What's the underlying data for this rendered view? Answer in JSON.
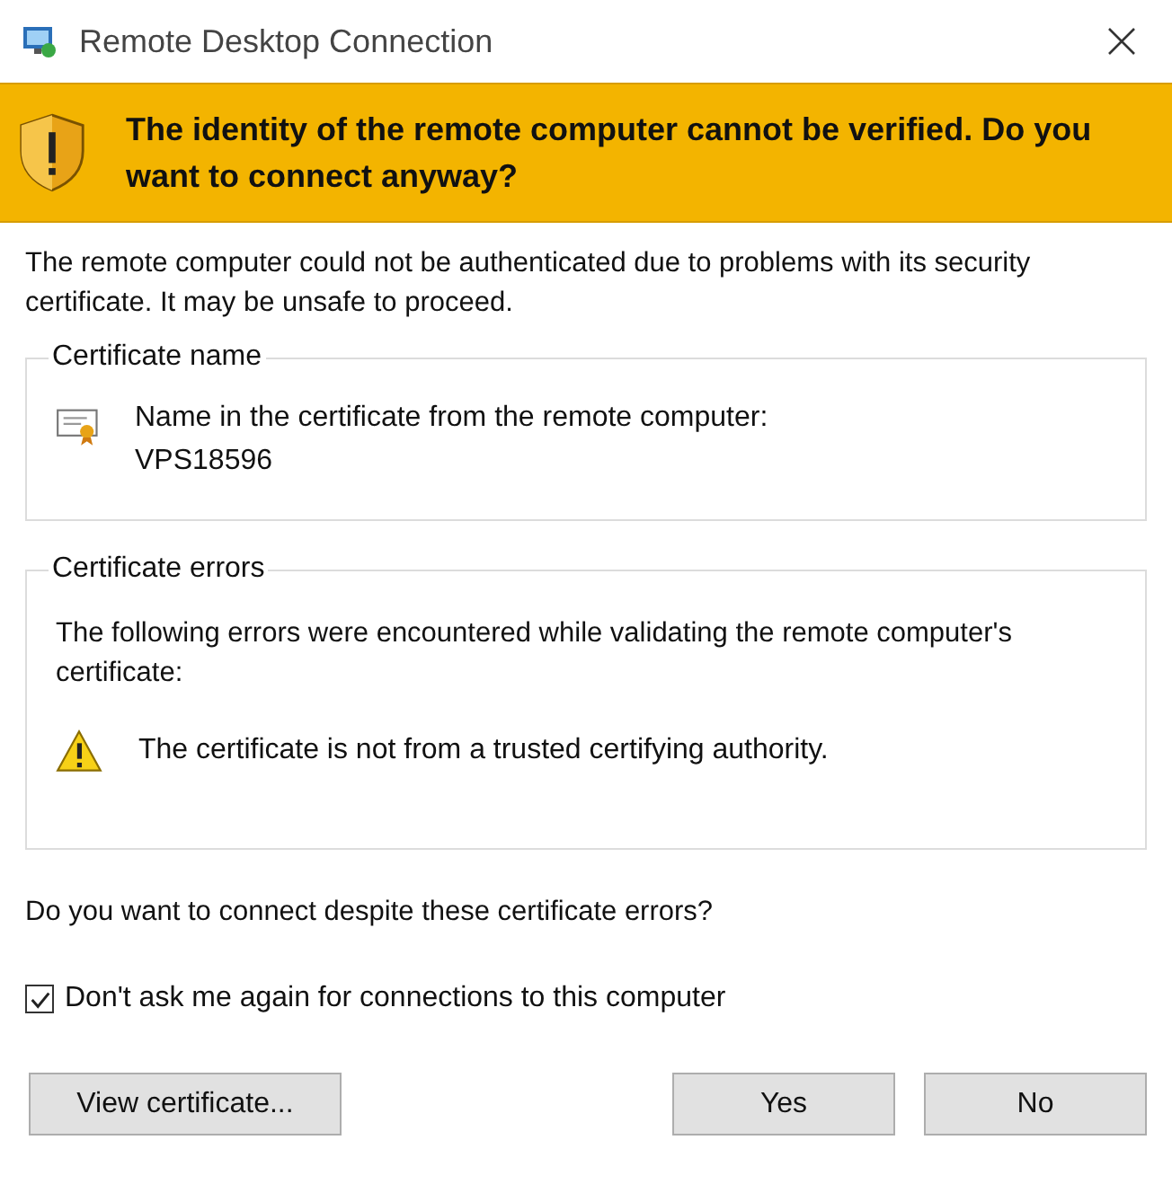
{
  "window": {
    "title": "Remote Desktop Connection"
  },
  "banner": {
    "text": "The identity of the remote computer cannot be verified. Do you want to connect anyway?"
  },
  "intro": "The remote computer could not be authenticated due to problems with its security certificate. It may be unsafe to proceed.",
  "certificate_name": {
    "title": "Certificate name",
    "label": "Name in the certificate from the remote computer:",
    "value": "VPS18596"
  },
  "certificate_errors": {
    "title": "Certificate errors",
    "description": "The following errors were encountered while validating the remote computer's certificate:",
    "errors": [
      "The certificate is not from a trusted certifying authority."
    ]
  },
  "question": "Do you want to connect despite these certificate errors?",
  "dont_ask": {
    "label": "Don't ask me again for connections to this computer",
    "checked": true
  },
  "buttons": [
    {
      "label": "View certificate...",
      "kind": "left"
    },
    {
      "label": "Yes",
      "kind": "right"
    },
    {
      "label": "No",
      "kind": "right"
    }
  ]
}
